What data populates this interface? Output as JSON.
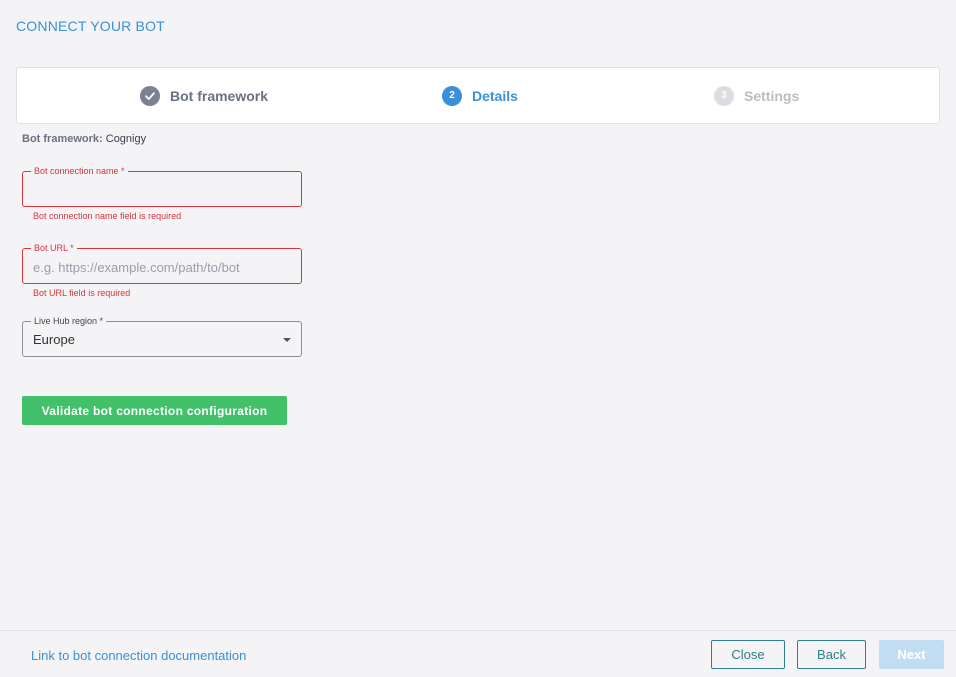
{
  "header": {
    "title": "CONNECT YOUR BOT"
  },
  "stepper": {
    "steps": [
      {
        "number": "",
        "label": "Bot framework",
        "state": "done"
      },
      {
        "number": "2",
        "label": "Details",
        "state": "active"
      },
      {
        "number": "3",
        "label": "Settings",
        "state": "inactive"
      }
    ]
  },
  "framework": {
    "key": "Bot framework:",
    "value": "Cognigy"
  },
  "form": {
    "connection_name": {
      "label": "Bot connection name *",
      "value": "",
      "placeholder": "",
      "error": "Bot connection name field is required"
    },
    "bot_url": {
      "label": "Bot URL *",
      "value": "",
      "placeholder": "e.g. https://example.com/path/to/bot",
      "error": "Bot URL field is required"
    },
    "region": {
      "label": "Live Hub region *",
      "selected": "Europe"
    },
    "validate_label": "Validate bot connection configuration"
  },
  "footer": {
    "doc_link": "Link to bot connection documentation",
    "close_label": "Close",
    "back_label": "Back",
    "next_label": "Next"
  },
  "colors": {
    "accent": "#3b8fd6",
    "error": "#d6353f",
    "success": "#43c06a"
  }
}
